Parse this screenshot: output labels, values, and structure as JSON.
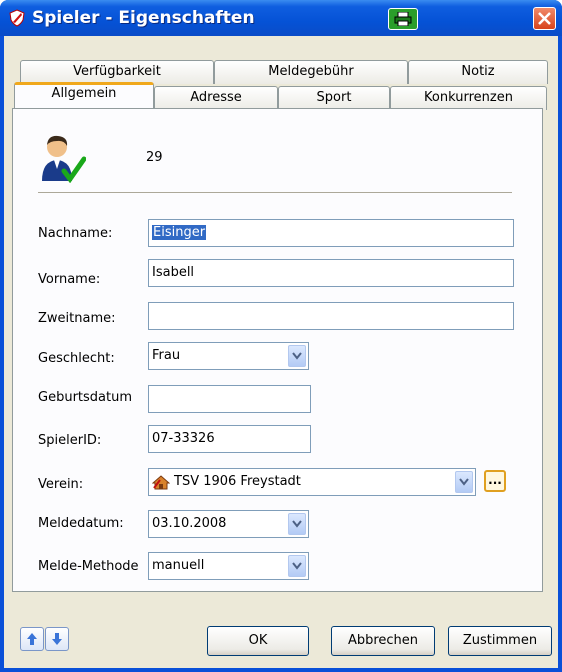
{
  "window": {
    "title": "Spieler - Eigenschaften"
  },
  "tabs": {
    "back_row": [
      "Verfügbarkeit",
      "Meldegebühr",
      "Notiz"
    ],
    "front_row": [
      "Allgemein",
      "Adresse",
      "Sport",
      "Konkurrenzen"
    ],
    "active": "Allgemein"
  },
  "general": {
    "player_number": "29",
    "fields": {
      "nachname": {
        "label": "Nachname:",
        "value": "Eisinger"
      },
      "vorname": {
        "label": "Vorname:",
        "value": "Isabell"
      },
      "zweitname": {
        "label": "Zweitname:",
        "value": ""
      },
      "geschlecht": {
        "label": "Geschlecht:",
        "value": "Frau"
      },
      "geburtsdatum": {
        "label": "Geburtsdatum",
        "value": ""
      },
      "spielerid": {
        "label": "SpielerID:",
        "value": "07-33326"
      },
      "verein": {
        "label": "Verein:",
        "value": "TSV 1906 Freystadt"
      },
      "meldedatum": {
        "label": "Meldedatum:",
        "value": "03.10.2008"
      },
      "meldemethode": {
        "label": "Melde-Methode",
        "value": "manuell"
      }
    },
    "browse_label": "..."
  },
  "buttons": {
    "ok": "OK",
    "cancel": "Abbrechen",
    "apply": "Zustimmen"
  },
  "icons": [
    "app-shield-icon",
    "print-icon",
    "close-icon",
    "player-avatar-icon",
    "club-icon",
    "chevron-down-icon",
    "arrow-up-icon",
    "arrow-down-icon"
  ],
  "colors": {
    "titlebar": "#0552d6",
    "active_tab_accent": "#f0a81c",
    "selection": "#316ac5"
  }
}
